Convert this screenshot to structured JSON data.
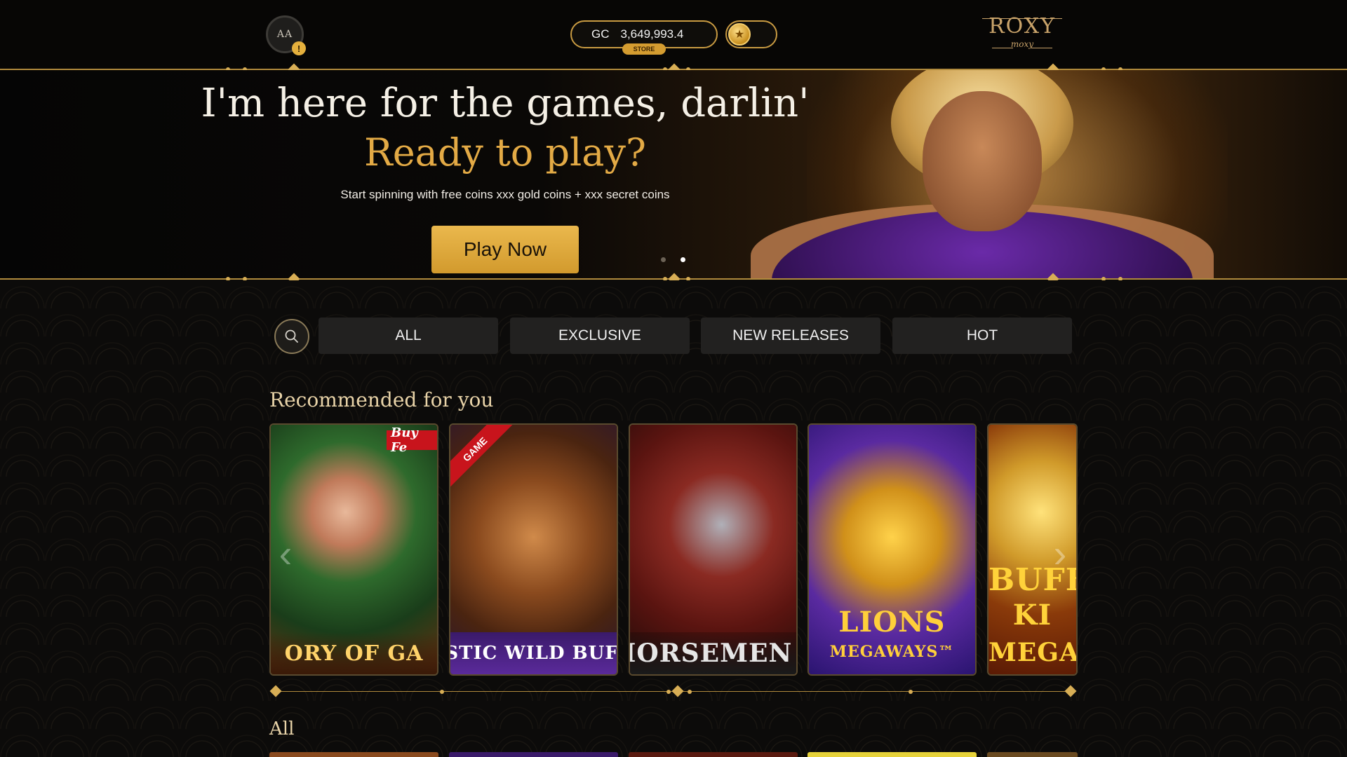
{
  "header": {
    "avatar_initials": "AA",
    "avatar_badge": "!",
    "balance_currency": "GC",
    "balance_amount": "3,649,993.4",
    "store_label": "STORE",
    "brand_name": "ROXY",
    "brand_sub": "moxy"
  },
  "hero": {
    "title": "I'm here for the games, darlin'",
    "subtitle": "Ready to play?",
    "description": "Start spinning with free coins xxx gold coins + xxx secret coins",
    "play_button": "Play Now"
  },
  "filters": {
    "search_icon": "search-icon",
    "tabs": [
      {
        "label": "ALL"
      },
      {
        "label": "EXCLUSIVE"
      },
      {
        "label": "NEW RELEASES"
      },
      {
        "label": "HOT"
      }
    ]
  },
  "recommended": {
    "title": "Recommended for you",
    "games": [
      {
        "label": "ORY OF GA",
        "badge": "Buy Fe"
      },
      {
        "label": "JESTIC WILD BUFFA",
        "ribbon": "GAME"
      },
      {
        "label": "HORSEMEN I"
      },
      {
        "label": "LIONS",
        "sub": "MEGAWAYS™"
      },
      {
        "label": "BUFF",
        "sub": "KI",
        "sub2": "MEGA"
      }
    ]
  },
  "all_section": {
    "title": "All"
  },
  "colors": {
    "gold": "#d8ae55",
    "accent_yellow": "#eab84d",
    "tab_bg": "#222120"
  }
}
